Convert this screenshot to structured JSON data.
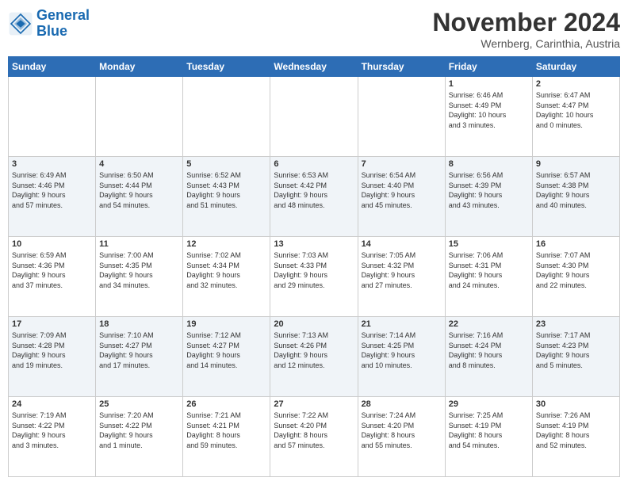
{
  "logo": {
    "line1": "General",
    "line2": "Blue"
  },
  "title": "November 2024",
  "subtitle": "Wernberg, Carinthia, Austria",
  "weekdays": [
    "Sunday",
    "Monday",
    "Tuesday",
    "Wednesday",
    "Thursday",
    "Friday",
    "Saturday"
  ],
  "weeks": [
    [
      {
        "day": "",
        "info": ""
      },
      {
        "day": "",
        "info": ""
      },
      {
        "day": "",
        "info": ""
      },
      {
        "day": "",
        "info": ""
      },
      {
        "day": "",
        "info": ""
      },
      {
        "day": "1",
        "info": "Sunrise: 6:46 AM\nSunset: 4:49 PM\nDaylight: 10 hours\nand 3 minutes."
      },
      {
        "day": "2",
        "info": "Sunrise: 6:47 AM\nSunset: 4:47 PM\nDaylight: 10 hours\nand 0 minutes."
      }
    ],
    [
      {
        "day": "3",
        "info": "Sunrise: 6:49 AM\nSunset: 4:46 PM\nDaylight: 9 hours\nand 57 minutes."
      },
      {
        "day": "4",
        "info": "Sunrise: 6:50 AM\nSunset: 4:44 PM\nDaylight: 9 hours\nand 54 minutes."
      },
      {
        "day": "5",
        "info": "Sunrise: 6:52 AM\nSunset: 4:43 PM\nDaylight: 9 hours\nand 51 minutes."
      },
      {
        "day": "6",
        "info": "Sunrise: 6:53 AM\nSunset: 4:42 PM\nDaylight: 9 hours\nand 48 minutes."
      },
      {
        "day": "7",
        "info": "Sunrise: 6:54 AM\nSunset: 4:40 PM\nDaylight: 9 hours\nand 45 minutes."
      },
      {
        "day": "8",
        "info": "Sunrise: 6:56 AM\nSunset: 4:39 PM\nDaylight: 9 hours\nand 43 minutes."
      },
      {
        "day": "9",
        "info": "Sunrise: 6:57 AM\nSunset: 4:38 PM\nDaylight: 9 hours\nand 40 minutes."
      }
    ],
    [
      {
        "day": "10",
        "info": "Sunrise: 6:59 AM\nSunset: 4:36 PM\nDaylight: 9 hours\nand 37 minutes."
      },
      {
        "day": "11",
        "info": "Sunrise: 7:00 AM\nSunset: 4:35 PM\nDaylight: 9 hours\nand 34 minutes."
      },
      {
        "day": "12",
        "info": "Sunrise: 7:02 AM\nSunset: 4:34 PM\nDaylight: 9 hours\nand 32 minutes."
      },
      {
        "day": "13",
        "info": "Sunrise: 7:03 AM\nSunset: 4:33 PM\nDaylight: 9 hours\nand 29 minutes."
      },
      {
        "day": "14",
        "info": "Sunrise: 7:05 AM\nSunset: 4:32 PM\nDaylight: 9 hours\nand 27 minutes."
      },
      {
        "day": "15",
        "info": "Sunrise: 7:06 AM\nSunset: 4:31 PM\nDaylight: 9 hours\nand 24 minutes."
      },
      {
        "day": "16",
        "info": "Sunrise: 7:07 AM\nSunset: 4:30 PM\nDaylight: 9 hours\nand 22 minutes."
      }
    ],
    [
      {
        "day": "17",
        "info": "Sunrise: 7:09 AM\nSunset: 4:28 PM\nDaylight: 9 hours\nand 19 minutes."
      },
      {
        "day": "18",
        "info": "Sunrise: 7:10 AM\nSunset: 4:27 PM\nDaylight: 9 hours\nand 17 minutes."
      },
      {
        "day": "19",
        "info": "Sunrise: 7:12 AM\nSunset: 4:27 PM\nDaylight: 9 hours\nand 14 minutes."
      },
      {
        "day": "20",
        "info": "Sunrise: 7:13 AM\nSunset: 4:26 PM\nDaylight: 9 hours\nand 12 minutes."
      },
      {
        "day": "21",
        "info": "Sunrise: 7:14 AM\nSunset: 4:25 PM\nDaylight: 9 hours\nand 10 minutes."
      },
      {
        "day": "22",
        "info": "Sunrise: 7:16 AM\nSunset: 4:24 PM\nDaylight: 9 hours\nand 8 minutes."
      },
      {
        "day": "23",
        "info": "Sunrise: 7:17 AM\nSunset: 4:23 PM\nDaylight: 9 hours\nand 5 minutes."
      }
    ],
    [
      {
        "day": "24",
        "info": "Sunrise: 7:19 AM\nSunset: 4:22 PM\nDaylight: 9 hours\nand 3 minutes."
      },
      {
        "day": "25",
        "info": "Sunrise: 7:20 AM\nSunset: 4:22 PM\nDaylight: 9 hours\nand 1 minute."
      },
      {
        "day": "26",
        "info": "Sunrise: 7:21 AM\nSunset: 4:21 PM\nDaylight: 8 hours\nand 59 minutes."
      },
      {
        "day": "27",
        "info": "Sunrise: 7:22 AM\nSunset: 4:20 PM\nDaylight: 8 hours\nand 57 minutes."
      },
      {
        "day": "28",
        "info": "Sunrise: 7:24 AM\nSunset: 4:20 PM\nDaylight: 8 hours\nand 55 minutes."
      },
      {
        "day": "29",
        "info": "Sunrise: 7:25 AM\nSunset: 4:19 PM\nDaylight: 8 hours\nand 54 minutes."
      },
      {
        "day": "30",
        "info": "Sunrise: 7:26 AM\nSunset: 4:19 PM\nDaylight: 8 hours\nand 52 minutes."
      }
    ]
  ]
}
